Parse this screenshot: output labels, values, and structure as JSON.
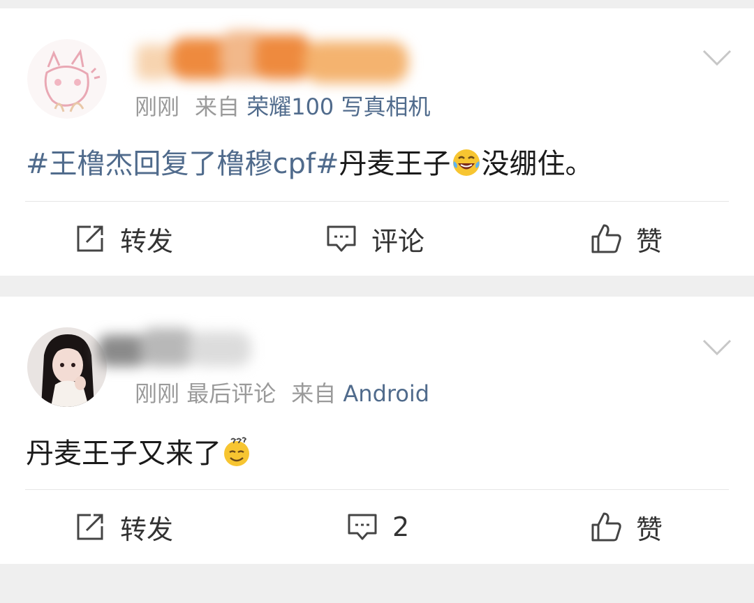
{
  "posts": [
    {
      "time": "刚刚",
      "source_prefix": "来自",
      "source": "荣耀100 写真相机",
      "hashtag": "#王橹杰回复了橹穆cpf#",
      "text_before_emoji": "丹麦王子",
      "text_after_emoji": "没绷住。",
      "emoji": "laughing-tears",
      "actions": {
        "repost": "转发",
        "comment": "评论",
        "like": "赞"
      }
    },
    {
      "time": "刚刚",
      "status": "最后评论",
      "source_prefix": "来自",
      "source": "Android",
      "text_before_emoji": "丹麦王子又来了",
      "emoji": "dizzy-face",
      "actions": {
        "repost": "转发",
        "comment": "2",
        "like": "赞"
      }
    }
  ],
  "colors": {
    "link": "#506b8c",
    "meta": "#9a9a9a",
    "text": "#1a1a1a",
    "separator": "#efefef"
  }
}
